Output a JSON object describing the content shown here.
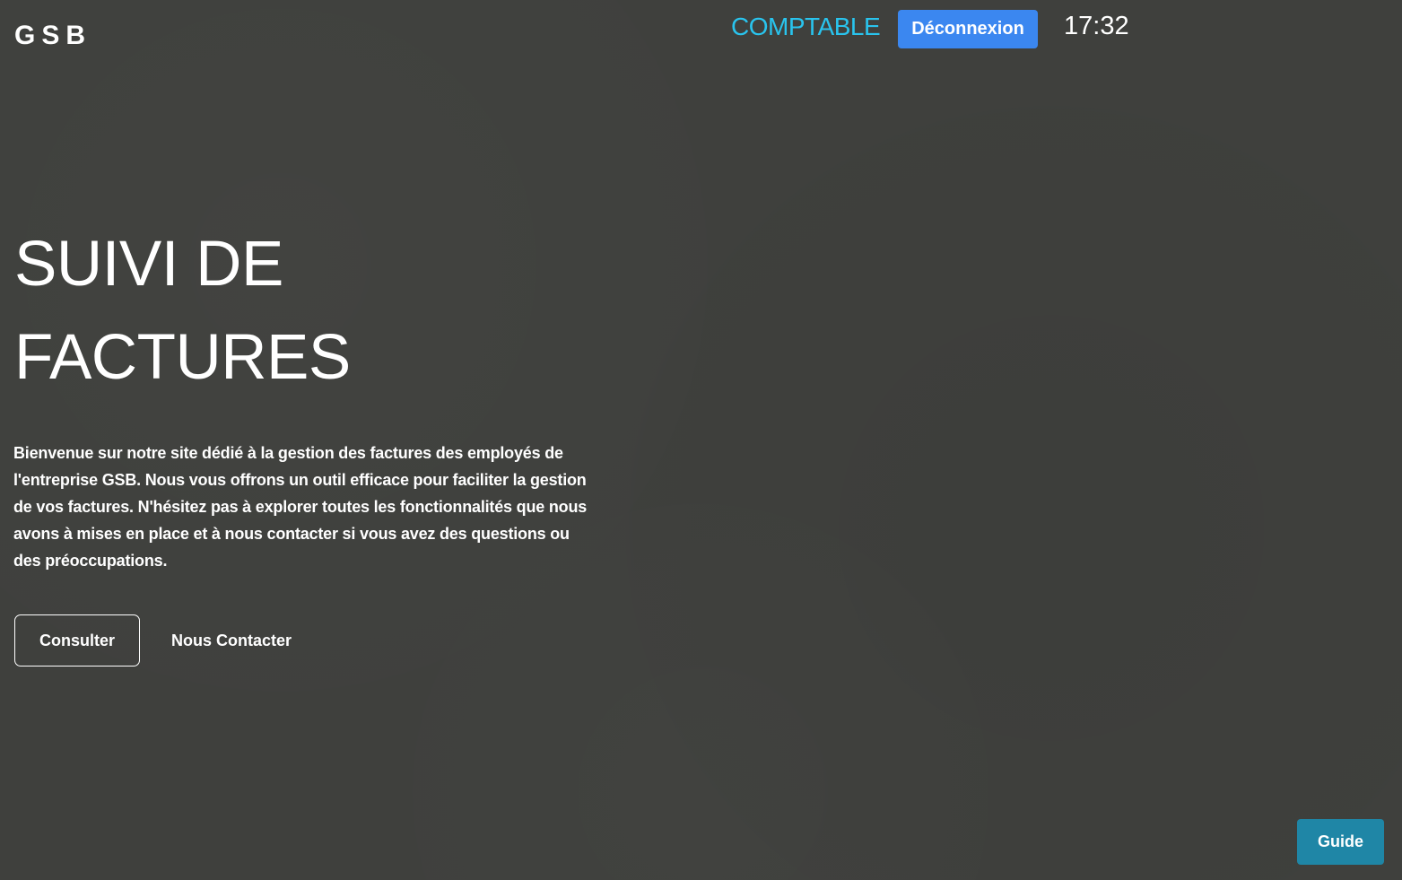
{
  "header": {
    "logo": "GSB",
    "role": "COMPTABLE",
    "logout_label": "Déconnexion",
    "clock": "17:32"
  },
  "hero": {
    "title_line1": "SUIVI DE",
    "title_line2": "FACTURES",
    "intro": "Bienvenue sur notre site dédié à la gestion des factures des employés de l'entreprise GSB. Nous vous offrons un outil efficace pour faciliter la gestion de vos factures. N'hésitez pas à explorer toutes les fonctionnalités que nous avons à mises en place et à nous contacter si vous avez des questions ou des préoccupations.",
    "consult_label": "Consulter",
    "contact_label": "Nous Contacter"
  },
  "footer": {
    "guide_label": "Guide"
  },
  "colors": {
    "background": "#3f403d",
    "role_text": "#29c4ee",
    "logout_button": "#3b87f0",
    "guide_button": "#1f86a6"
  }
}
